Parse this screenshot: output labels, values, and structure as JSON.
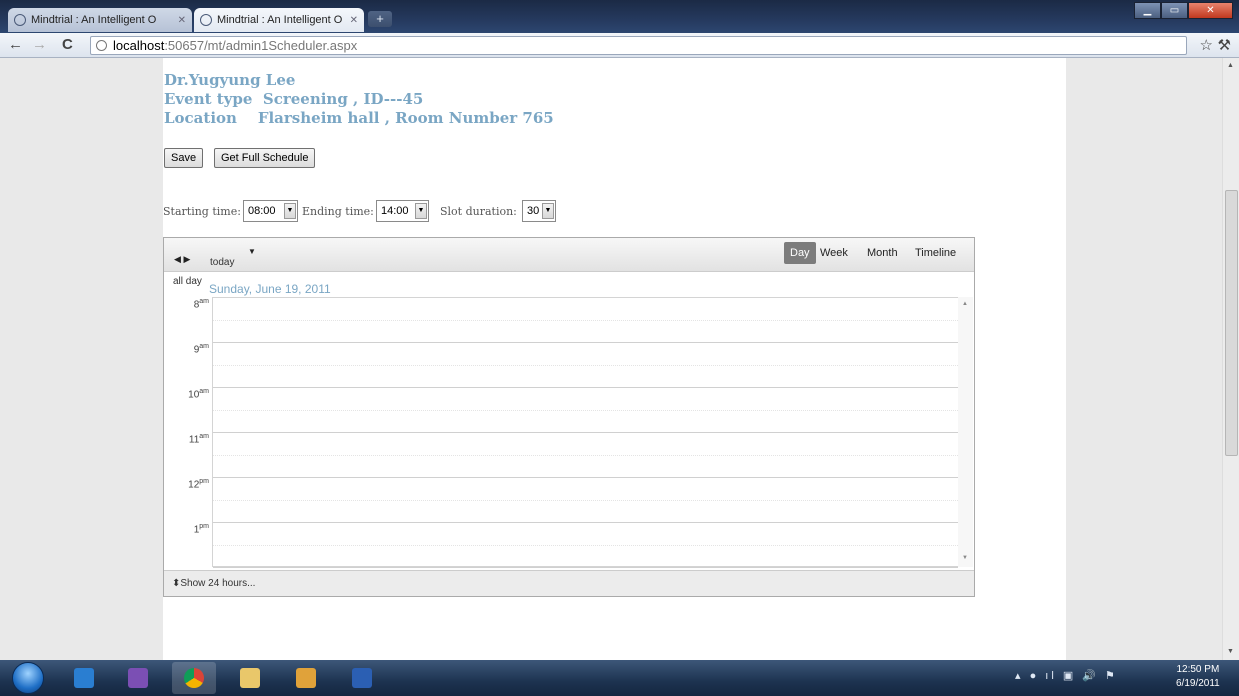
{
  "browser": {
    "tabs": [
      {
        "title": "Mindtrial : An Intelligent O"
      },
      {
        "title": "Mindtrial : An Intelligent O"
      }
    ],
    "new_tab": "+",
    "url_host": "localhost",
    "url_rest": ":50657/mt/admin1Scheduler.aspx"
  },
  "event": {
    "doctor": "Dr.Yugyung Lee",
    "event_type_line": "Event type  Screening , ID---45",
    "location_line": "Location    Flarsheim hall , Room Number 765"
  },
  "buttons": {
    "save": "Save",
    "full_schedule": "Get Full Schedule"
  },
  "time_settings": {
    "starting_label": "Starting time:",
    "starting_value": "08:00",
    "ending_label": "Ending time:",
    "ending_value": "14:00",
    "slot_label": "Slot duration:",
    "slot_value": "30"
  },
  "calendar": {
    "today_label": "today",
    "views": [
      "Day",
      "Week",
      "Month",
      "Timeline"
    ],
    "active_view": "Day",
    "all_day_label": "all day",
    "date_heading": "Sunday, June 19, 2011",
    "hours": [
      {
        "h": "8",
        "ampm": "am"
      },
      {
        "h": "9",
        "ampm": "am"
      },
      {
        "h": "10",
        "ampm": "am"
      },
      {
        "h": "11",
        "ampm": "am"
      },
      {
        "h": "12",
        "ampm": "pm"
      },
      {
        "h": "1",
        "ampm": "pm"
      }
    ],
    "show_24_label": "Show 24 hours..."
  },
  "taskbar": {
    "time": "12:50 PM",
    "date": "6/19/2011"
  },
  "colors": {
    "accent_text": "#7aa6c4",
    "active_view_bg": "#7c7c7c"
  }
}
